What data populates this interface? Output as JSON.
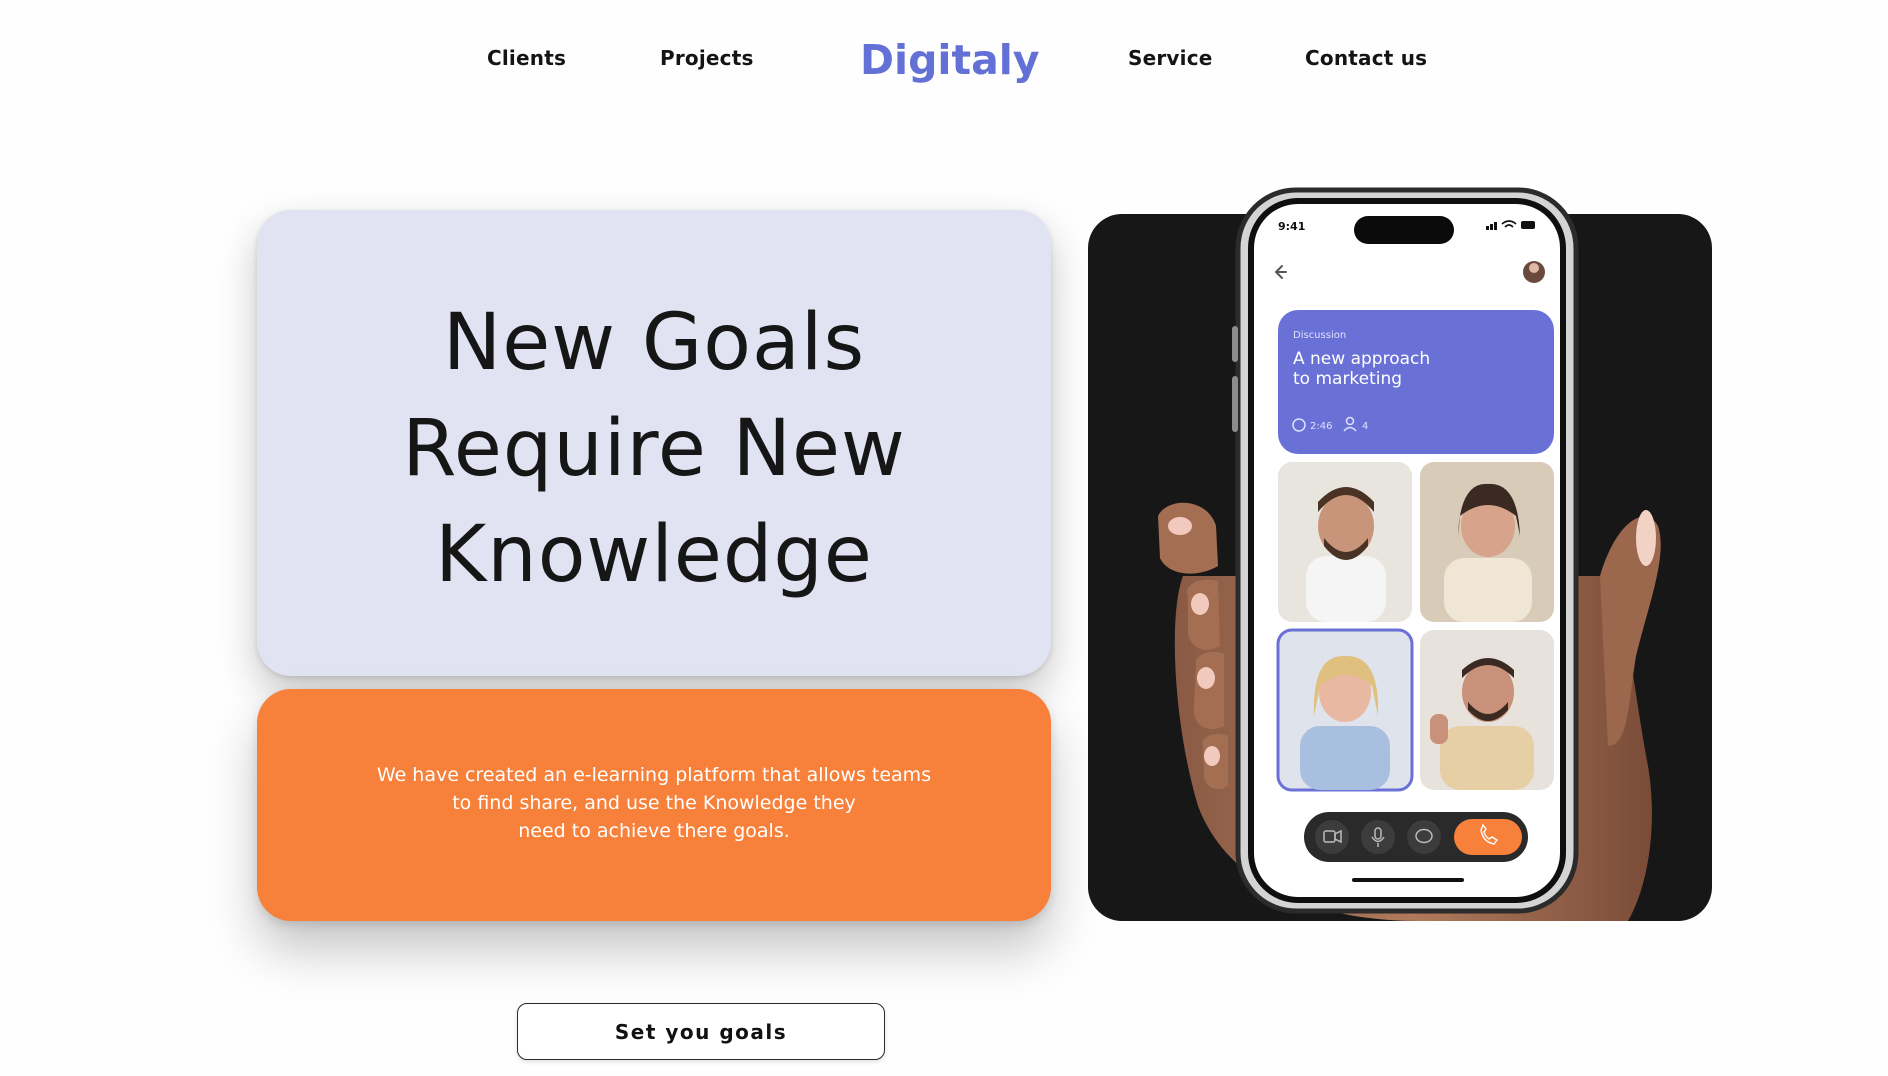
{
  "nav": {
    "left_links": [
      "Clients",
      "Projects"
    ],
    "brand": "Digitaly",
    "right_links": [
      "Service",
      "Contact us"
    ]
  },
  "hero": {
    "title_lines": [
      "New Goals",
      "Require New",
      "Knowledge"
    ]
  },
  "description": {
    "lines": [
      "We have created an e-learning platform that allows teams",
      "to find share, and use the Knowledge they",
      "need to achieve there goals."
    ]
  },
  "cta": {
    "label": "Set you goals"
  },
  "phone": {
    "status_time": "9:41",
    "card_tag": "Discussion",
    "card_title_lines": [
      "A new approach",
      "to marketing"
    ],
    "card_duration": "2:46",
    "card_participants": "4"
  },
  "colors": {
    "brand": "#6370d5",
    "accent_orange": "#f7803a",
    "hero_card_bg": "#e1e2f2",
    "phone_card": "#6a71d6",
    "media_bg": "#171717"
  },
  "icons": [
    "back-arrow-icon",
    "clock-icon",
    "user-icon",
    "video-icon",
    "microphone-icon",
    "chat-icon",
    "phone-icon",
    "signal-icon",
    "wifi-icon",
    "battery-icon"
  ]
}
